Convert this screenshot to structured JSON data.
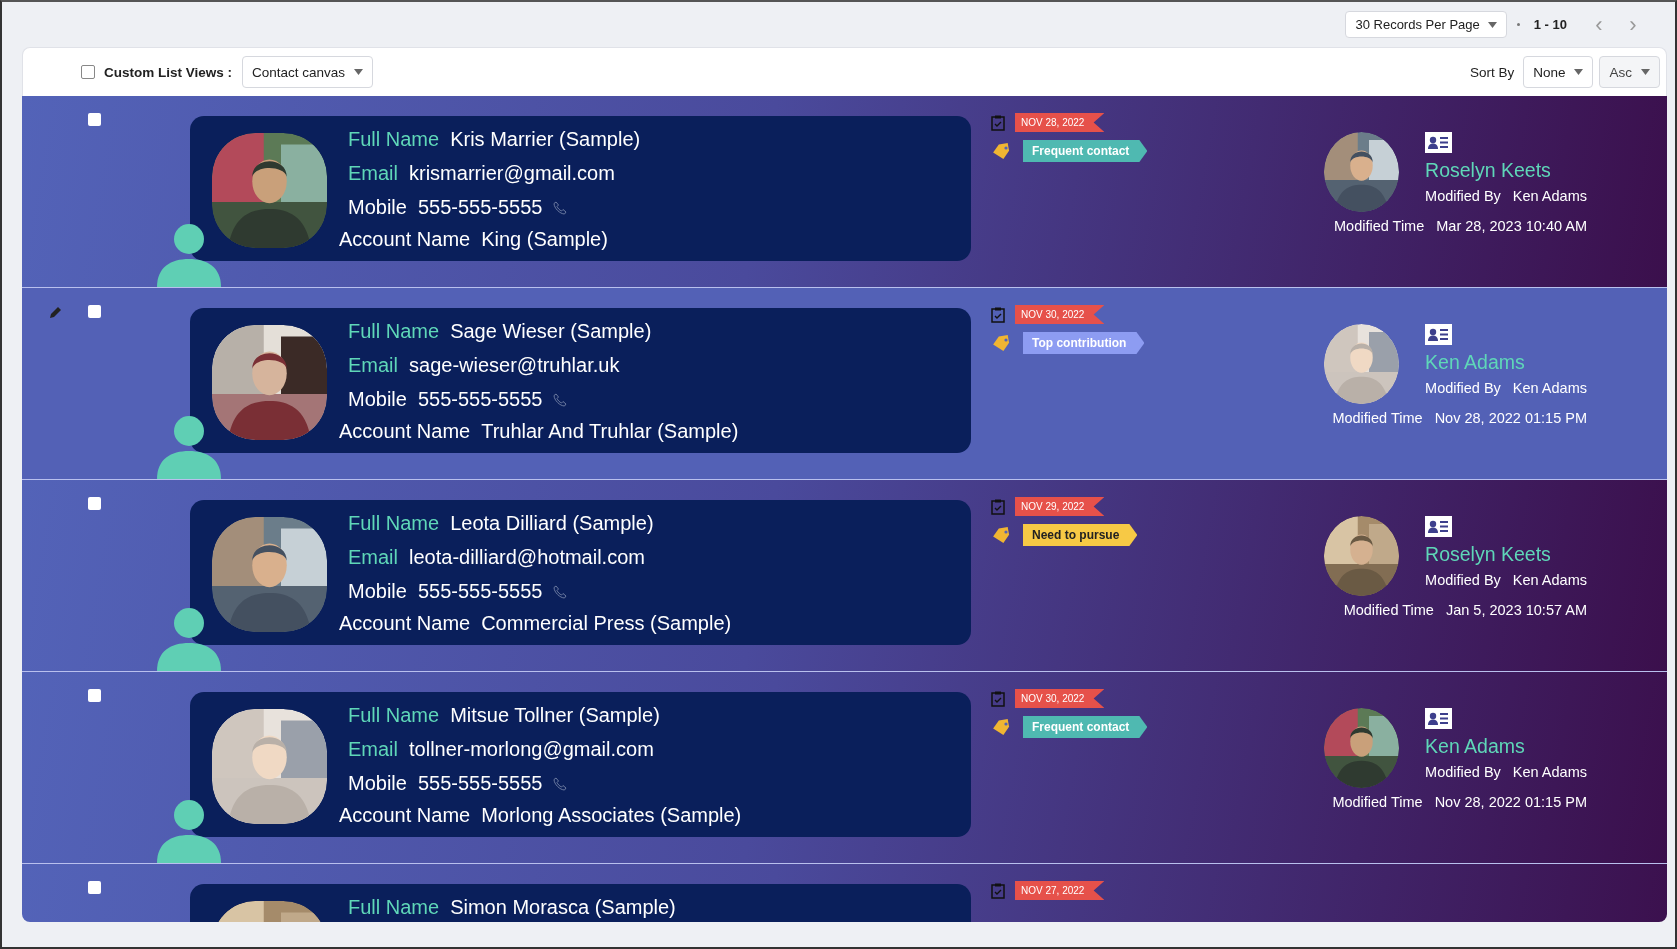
{
  "pagination": {
    "per_page": "30 Records Per Page",
    "range": "1 - 10",
    "prev": "‹",
    "next": "›"
  },
  "toolbar": {
    "select_all_checked": false,
    "custom_list_label": "Custom List Views :",
    "view": "Contact canvas",
    "sort_label": "Sort By",
    "sort_field": "None",
    "sort_order": "Asc"
  },
  "rows": [
    {
      "checked": false,
      "hovered": false,
      "fields": [
        {
          "kind": "accent",
          "label": "Full Name",
          "value": "Kris Marrier (Sample)"
        },
        {
          "kind": "accent",
          "label": "Email",
          "value": "krismarrier@gmail.com"
        },
        {
          "kind": "phone",
          "label": "Mobile",
          "value": "555-555-5555"
        },
        {
          "kind": "plain",
          "label": "Account Name",
          "value": "King (Sample)"
        }
      ],
      "date": "NOV 28, 2022",
      "tag": {
        "label": "Frequent contact",
        "color": "#4fb9b1"
      },
      "owner": "Roselyn Keets",
      "modified_by": {
        "label": "Modified By",
        "value": "Ken Adams"
      },
      "modified_time": {
        "label": "Modified Time",
        "value": "Mar 28, 2023 10:40 AM"
      }
    },
    {
      "checked": false,
      "hovered": true,
      "fields": [
        {
          "kind": "accent",
          "label": "Full Name",
          "value": "Sage Wieser (Sample)"
        },
        {
          "kind": "accent",
          "label": "Email",
          "value": "sage-wieser@truhlar.uk"
        },
        {
          "kind": "phone",
          "label": "Mobile",
          "value": "555-555-5555"
        },
        {
          "kind": "plain",
          "label": "Account Name",
          "value": "Truhlar And Truhlar (Sample)"
        }
      ],
      "date": "NOV 30, 2022",
      "tag": {
        "label": "Top contribution",
        "color": "#8d9cf2"
      },
      "owner": "Ken Adams",
      "modified_by": {
        "label": "Modified By",
        "value": "Ken Adams"
      },
      "modified_time": {
        "label": "Modified Time",
        "value": "Nov 28, 2022 01:15 PM"
      }
    },
    {
      "checked": false,
      "hovered": false,
      "fields": [
        {
          "kind": "accent",
          "label": "Full Name",
          "value": "Leota Dilliard (Sample)"
        },
        {
          "kind": "accent",
          "label": "Email",
          "value": "leota-dilliard@hotmail.com"
        },
        {
          "kind": "phone",
          "label": "Mobile",
          "value": "555-555-5555"
        },
        {
          "kind": "plain",
          "label": "Account Name",
          "value": "Commercial Press (Sample)"
        }
      ],
      "date": "NOV 29, 2022",
      "tag": {
        "label": "Need to pursue",
        "color": "#f7c945"
      },
      "owner": "Roselyn Keets",
      "modified_by": {
        "label": "Modified By",
        "value": "Ken Adams"
      },
      "modified_time": {
        "label": "Modified Time",
        "value": "Jan 5, 2023 10:57 AM"
      }
    },
    {
      "checked": false,
      "hovered": false,
      "fields": [
        {
          "kind": "accent",
          "label": "Full Name",
          "value": "Mitsue Tollner (Sample)"
        },
        {
          "kind": "accent",
          "label": "Email",
          "value": "tollner-morlong@gmail.com"
        },
        {
          "kind": "phone",
          "label": "Mobile",
          "value": "555-555-5555"
        },
        {
          "kind": "plain",
          "label": "Account Name",
          "value": "Morlong Associates (Sample)"
        }
      ],
      "date": "NOV 30, 2022",
      "tag": {
        "label": "Frequent contact",
        "color": "#4fb9b1"
      },
      "owner": "Ken Adams",
      "modified_by": {
        "label": "Modified By",
        "value": "Ken Adams"
      },
      "modified_time": {
        "label": "Modified Time",
        "value": "Nov 28, 2022 01:15 PM"
      }
    },
    {
      "checked": false,
      "hovered": false,
      "fields": [
        {
          "kind": "accent",
          "label": "Full Name",
          "value": "Simon Morasca (Sample)"
        }
      ],
      "date": "NOV 27, 2022"
    }
  ]
}
